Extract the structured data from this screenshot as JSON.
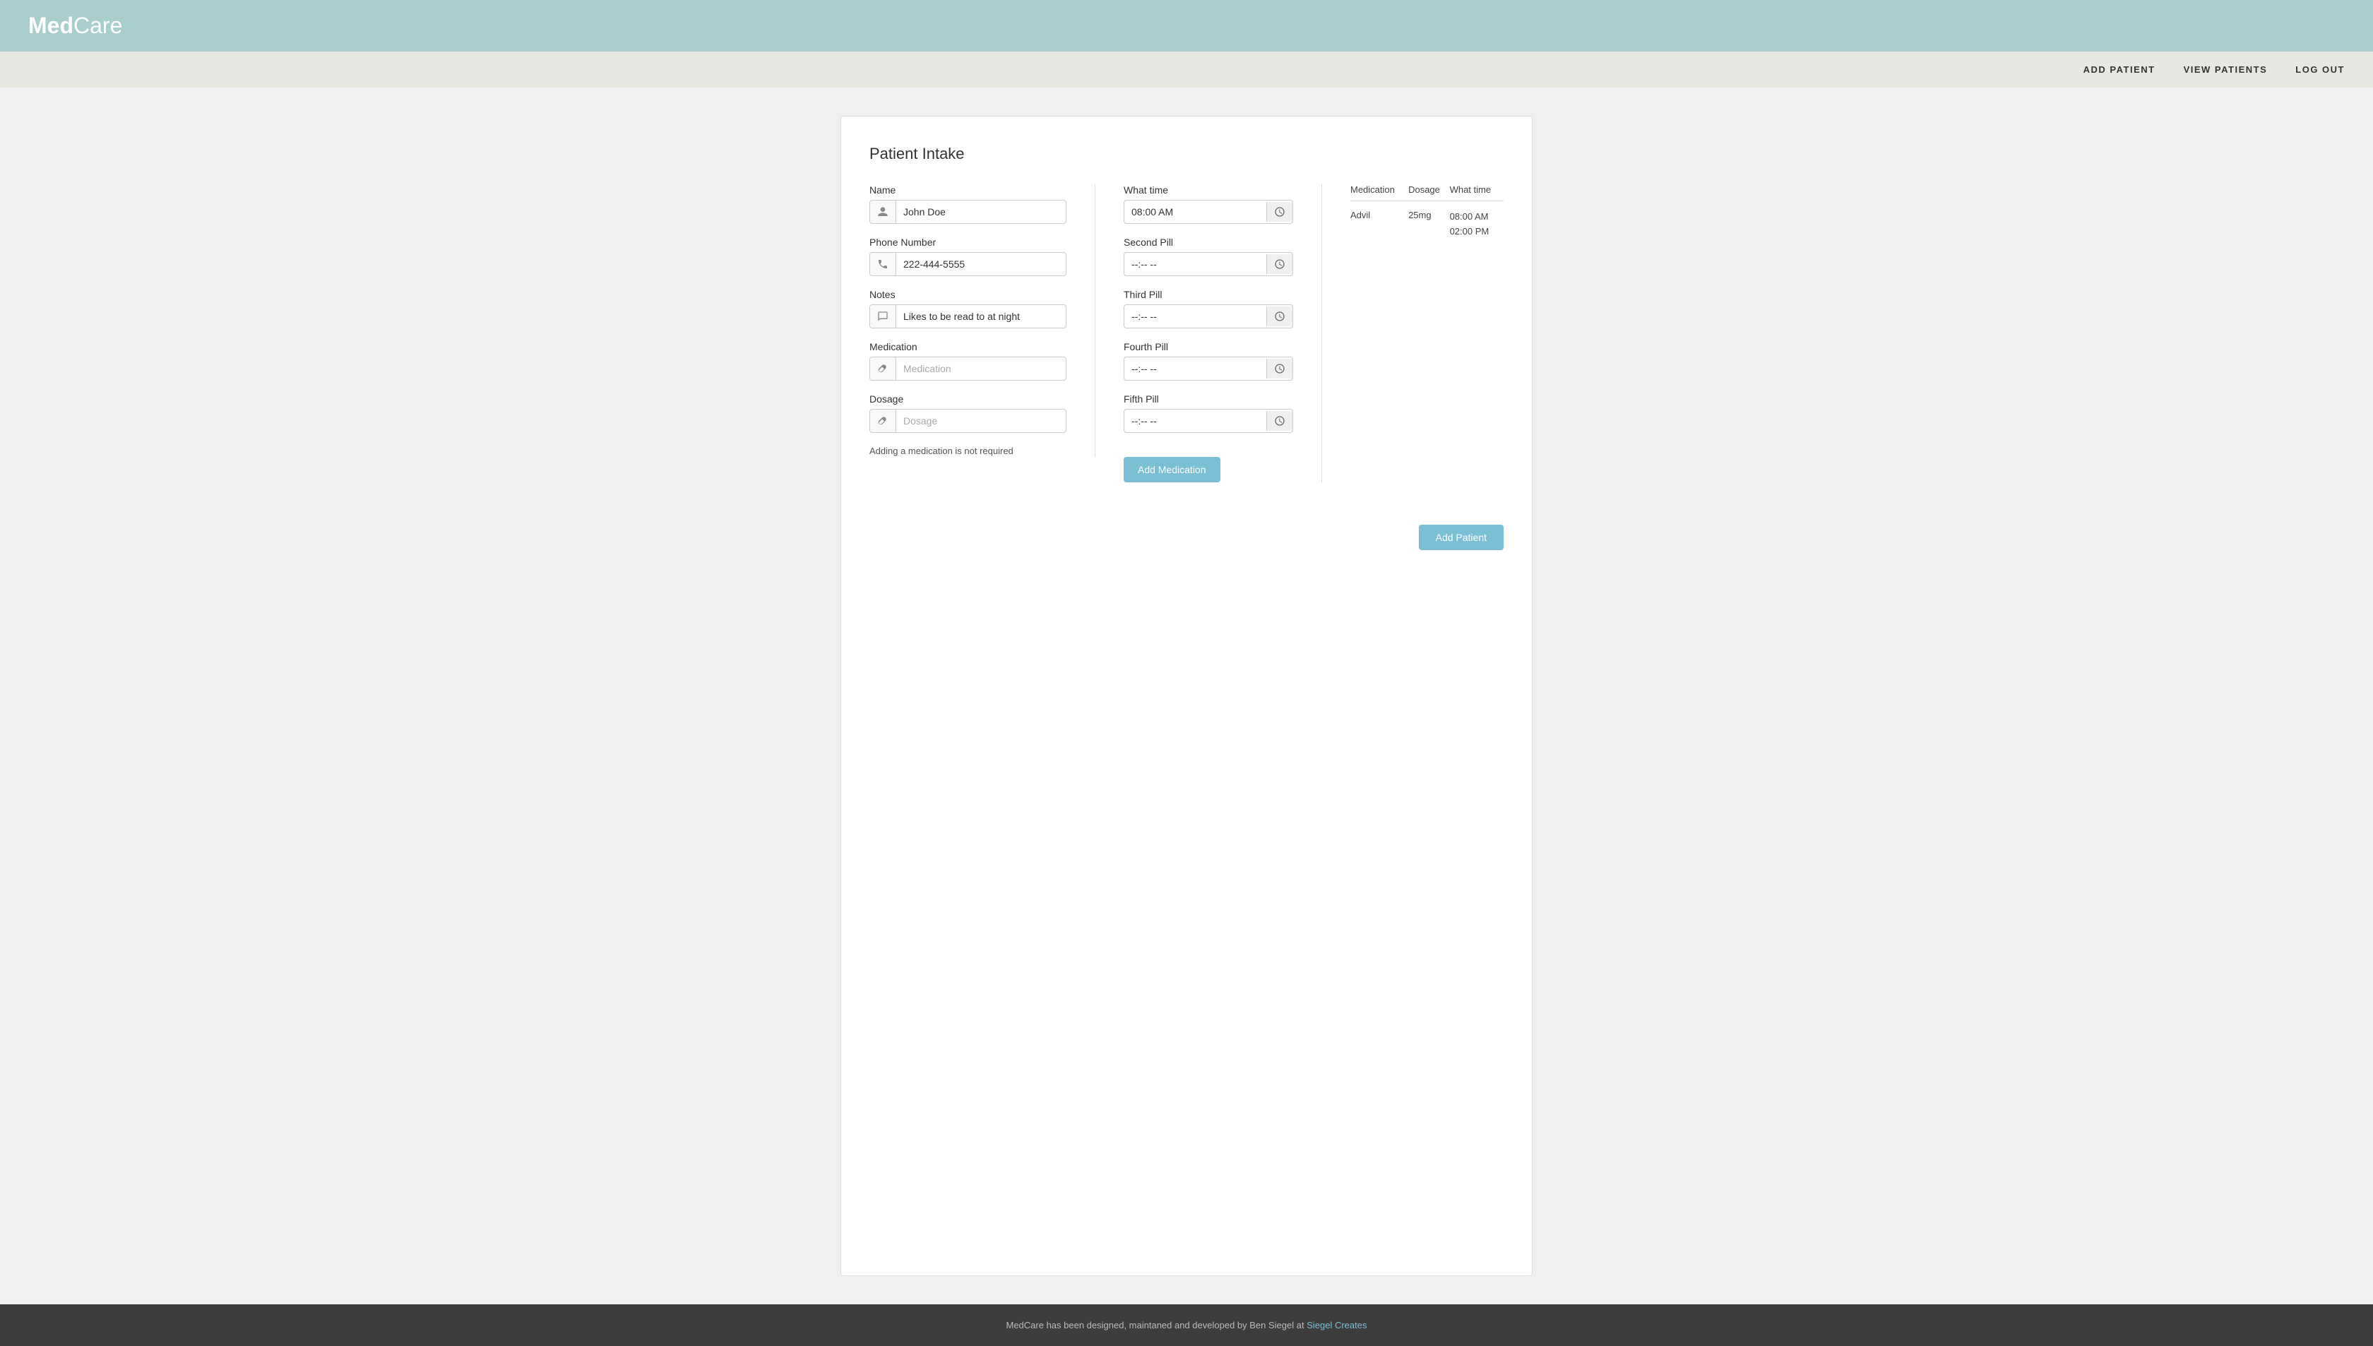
{
  "header": {
    "logo_bold": "Med",
    "logo_light": "Care",
    "nav": {
      "add_patient": "ADD PATIENT",
      "view_patients": "VIEW PATIENTS",
      "log_out": "LOG OUT"
    }
  },
  "form": {
    "title": "Patient Intake",
    "left": {
      "name_label": "Name",
      "name_value": "John Doe",
      "name_placeholder": "John Doe",
      "phone_label": "Phone Number",
      "phone_value": "222-444-5555",
      "phone_placeholder": "222-444-5555",
      "notes_label": "Notes",
      "notes_value": "Likes to be read to at night",
      "notes_placeholder": "Likes to be read to at night",
      "medication_label": "Medication",
      "medication_placeholder": "Medication",
      "dosage_label": "Dosage",
      "dosage_placeholder": "Dosage",
      "help_text": "Adding a medication is not required"
    },
    "middle": {
      "what_time_label": "What time",
      "what_time_value": "08:00 AM",
      "second_pill_label": "Second Pill",
      "second_pill_value": "--:-- --",
      "third_pill_label": "Third Pill",
      "third_pill_value": "--:-- --",
      "fourth_pill_label": "Fourth Pill",
      "fourth_pill_value": "--:-- --",
      "fifth_pill_label": "Fifth Pill",
      "fifth_pill_value": "--:-- --",
      "add_medication_btn": "Add Medication"
    },
    "right": {
      "col_medication": "Medication",
      "col_dosage": "Dosage",
      "col_what_time": "What time",
      "rows": [
        {
          "medication": "Advil",
          "dosage": "25mg",
          "times": [
            "08:00 AM",
            "02:00 PM"
          ]
        }
      ]
    },
    "add_patient_btn": "Add Patient"
  },
  "footer": {
    "text": "MedCare has been designed, maintaned and developed by Ben Siegel at ",
    "link_text": "Siegel Creates",
    "link_href": "#"
  },
  "icons": {
    "user": "👤",
    "phone": "📞",
    "notes": "📋",
    "medication": "💊",
    "clock": "🕐"
  }
}
